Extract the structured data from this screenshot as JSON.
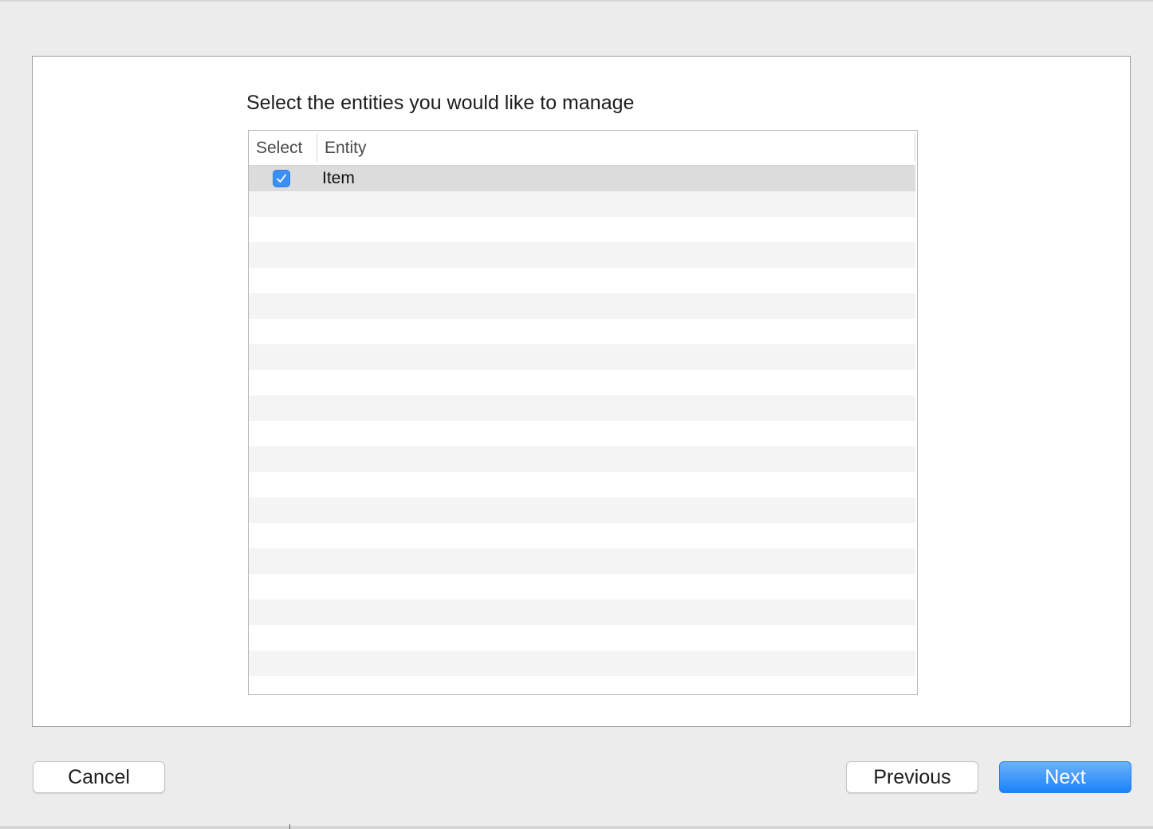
{
  "dialog": {
    "instruction": "Select the entities you would like to manage"
  },
  "table": {
    "columns": [
      "Select",
      "Entity"
    ],
    "rows": [
      {
        "selected": true,
        "entity": "Item"
      }
    ]
  },
  "buttons": {
    "cancel": "Cancel",
    "previous": "Previous",
    "next": "Next"
  },
  "colors": {
    "accent": "#1a82fb",
    "checkbox": "#3b8ff5",
    "selected_row": "#dcdcdc",
    "stripe": "#f4f4f4"
  },
  "icons": {
    "checkbox": "checkmark-icon"
  }
}
